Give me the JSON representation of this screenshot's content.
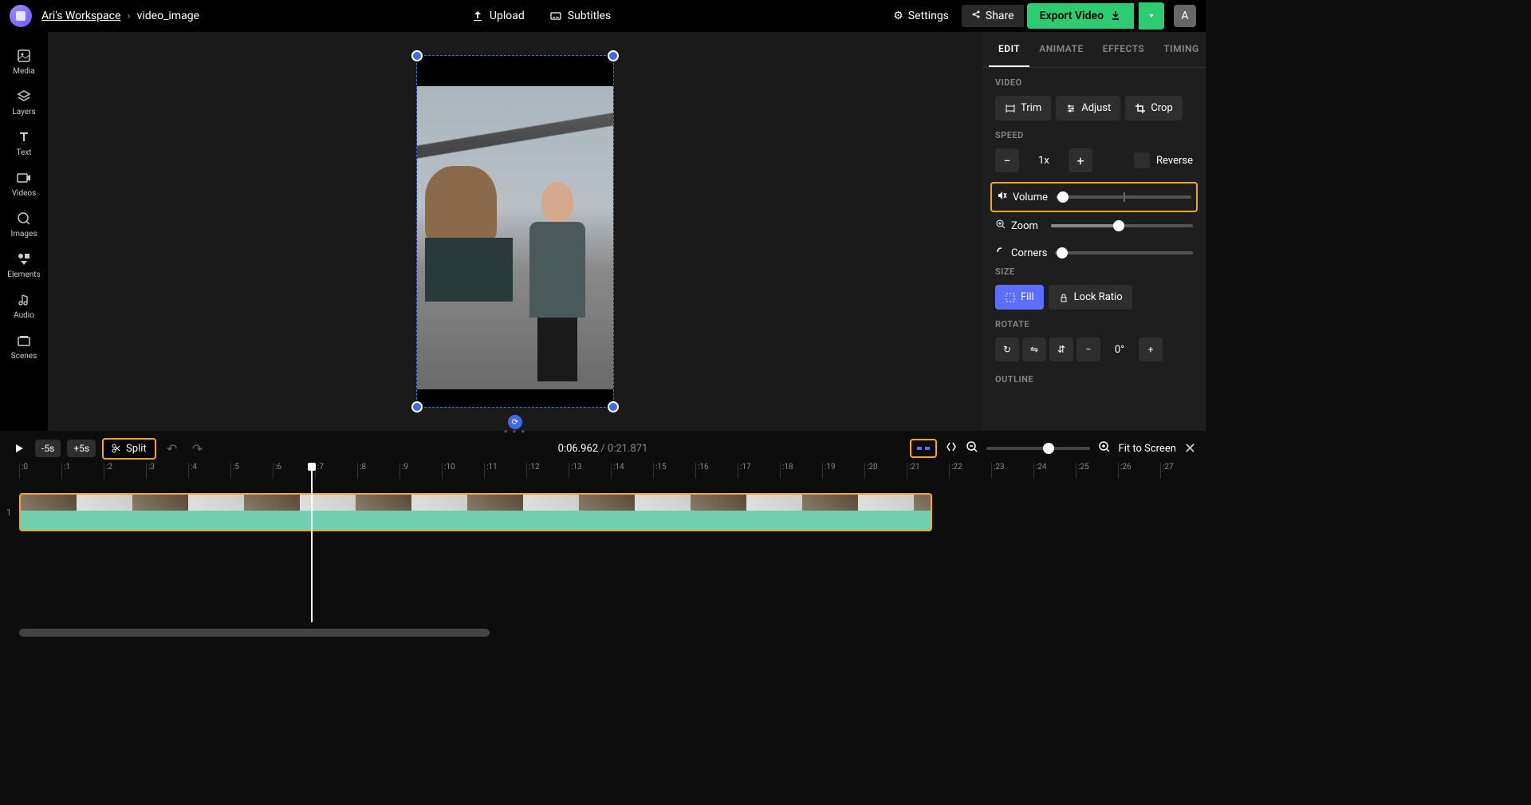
{
  "header": {
    "workspace": "Ari's Workspace",
    "project": "video_image",
    "upload": "Upload",
    "subtitles": "Subtitles",
    "settings": "Settings",
    "share": "Share",
    "export": "Export Video",
    "avatar_letter": "A"
  },
  "sidebar": {
    "media": "Media",
    "layers": "Layers",
    "text": "Text",
    "videos": "Videos",
    "images": "Images",
    "elements": "Elements",
    "audio": "Audio",
    "scenes": "Scenes"
  },
  "panel": {
    "tabs": {
      "edit": "EDIT",
      "animate": "ANIMATE",
      "effects": "EFFECTS",
      "timing": "TIMING"
    },
    "video_label": "VIDEO",
    "trim": "Trim",
    "adjust": "Adjust",
    "crop": "Crop",
    "speed_label": "SPEED",
    "speed_value": "1x",
    "reverse": "Reverse",
    "volume": "Volume",
    "zoom": "Zoom",
    "corners": "Corners",
    "size_label": "SIZE",
    "fill": "Fill",
    "lock_ratio": "Lock Ratio",
    "rotate_label": "ROTATE",
    "rotate_value": "0°",
    "outline_label": "OUTLINE"
  },
  "timeline": {
    "back5": "-5s",
    "fwd5": "+5s",
    "split": "Split",
    "current_time": "0:06.962",
    "total_time": "0:21.871",
    "fit": "Fit to Screen",
    "ruler": [
      ":0",
      ":1",
      ":2",
      ":3",
      ":4",
      ":5",
      ":6",
      ":7",
      ":8",
      ":9",
      ":10",
      ":11",
      ":12",
      ":13",
      ":14",
      ":15",
      ":16",
      ":17",
      ":18",
      ":19",
      ":20",
      ":21",
      ":22",
      ":23",
      ":24",
      ":25",
      ":26",
      ":27"
    ],
    "track_num": "1"
  }
}
